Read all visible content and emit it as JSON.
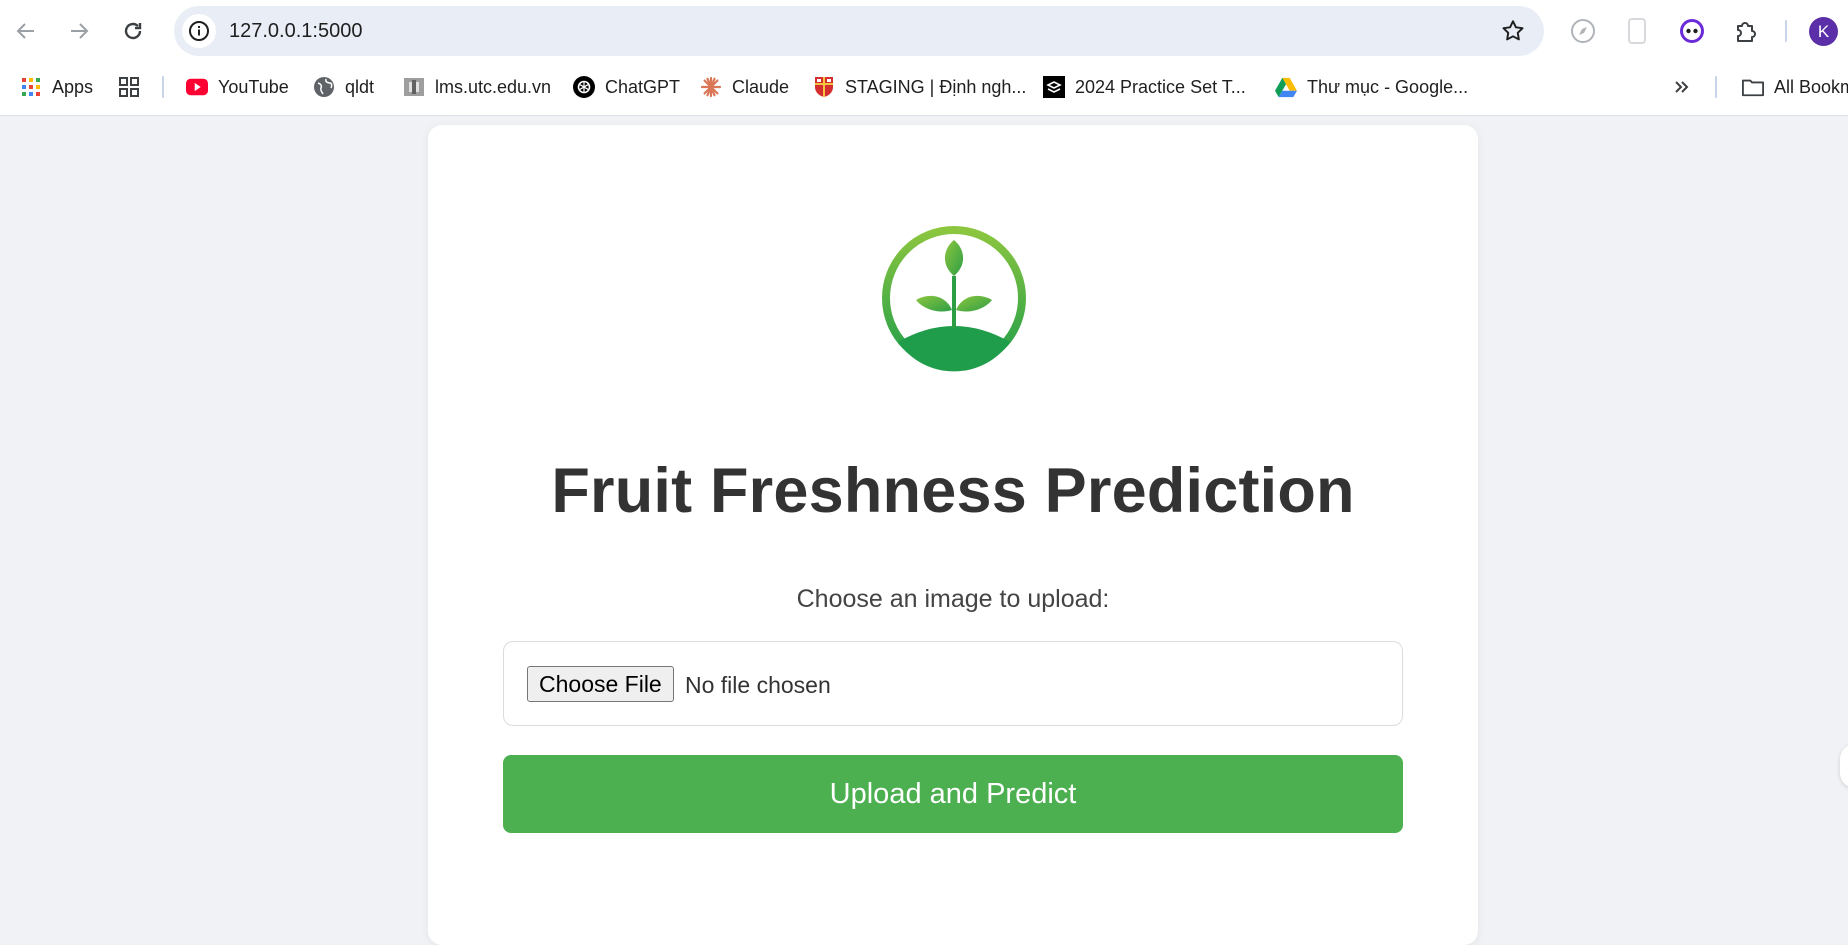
{
  "browser": {
    "url": "127.0.0.1:5000",
    "profile_initial": "K",
    "bookmarks": [
      {
        "label": "Apps",
        "icon": "apps-grid-icon"
      },
      {
        "label": "YouTube",
        "icon": "youtube-icon"
      },
      {
        "label": "qldt",
        "icon": "globe-icon"
      },
      {
        "label": "lms.utc.edu.vn",
        "icon": "lms-icon"
      },
      {
        "label": "ChatGPT",
        "icon": "chatgpt-icon"
      },
      {
        "label": "Claude",
        "icon": "claude-icon"
      },
      {
        "label": "STAGING | Định ngh...",
        "icon": "cambridge-shield-icon"
      },
      {
        "label": "2024 Practice Set T...",
        "icon": "practice-set-icon"
      },
      {
        "label": "Thư mục - Google...",
        "icon": "google-drive-icon"
      }
    ],
    "all_bookmarks_label": "All Bookm"
  },
  "page": {
    "title": "Fruit Freshness Prediction",
    "upload_label": "Choose an image to upload:",
    "file_button_label": "Choose File",
    "file_status": "No file chosen",
    "submit_label": "Upload and Predict"
  },
  "colors": {
    "accent_green": "#4caf50",
    "title_text": "#333333",
    "page_background": "#f0f2f5",
    "omnibox": "#e9eef6"
  }
}
